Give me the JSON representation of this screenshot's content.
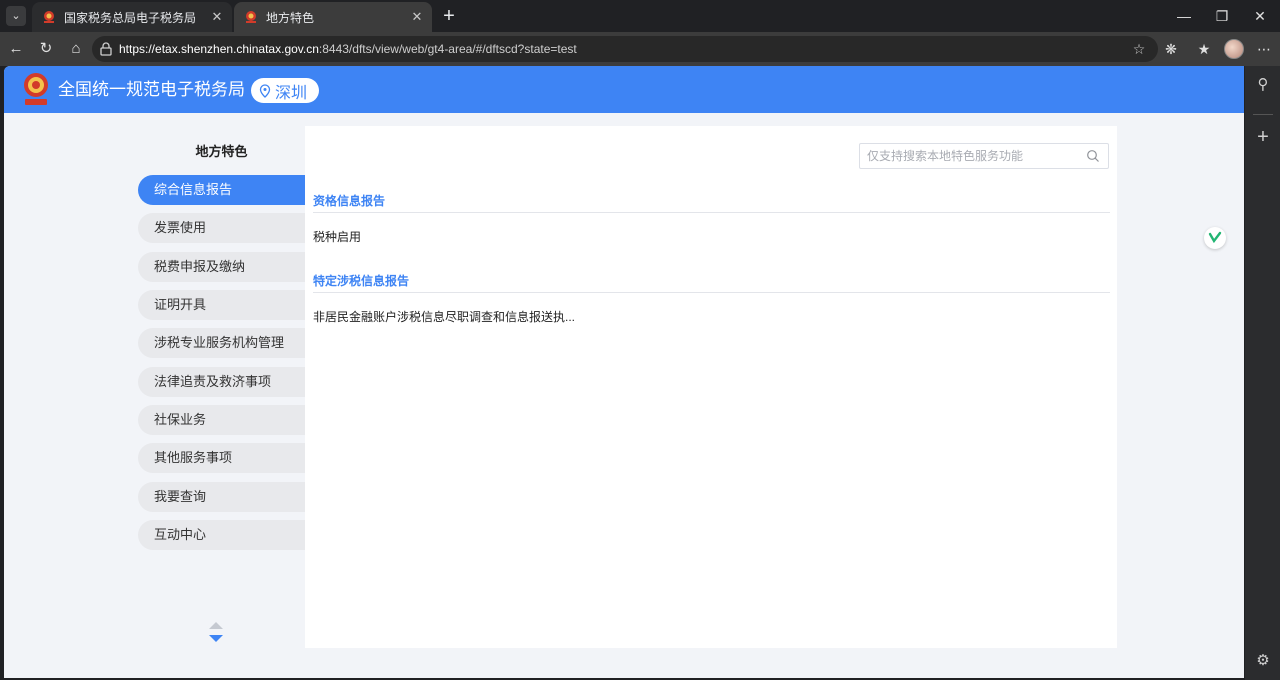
{
  "browser": {
    "tabs": [
      {
        "title": "国家税务总局电子税务局",
        "active": false
      },
      {
        "title": "地方特色",
        "active": true
      }
    ],
    "new_tab": "+",
    "url_host": "https://etax.shenzhen.chinatax.gov.cn",
    "url_rest": ":8443/dfts/view/web/gt4-area/#/dftscd?state=test"
  },
  "header": {
    "site_title": "全国统一规范电子税务局",
    "city": "深圳"
  },
  "sidebar": {
    "title": "地方特色",
    "items": [
      {
        "label": "综合信息报告",
        "active": true
      },
      {
        "label": "发票使用",
        "active": false
      },
      {
        "label": "税费申报及缴纳",
        "active": false
      },
      {
        "label": "证明开具",
        "active": false
      },
      {
        "label": "涉税专业服务机构管理",
        "active": false
      },
      {
        "label": "法律追责及救济事项",
        "active": false
      },
      {
        "label": "社保业务",
        "active": false
      },
      {
        "label": "其他服务事项",
        "active": false
      },
      {
        "label": "我要查询",
        "active": false
      },
      {
        "label": "互动中心",
        "active": false
      }
    ]
  },
  "search": {
    "placeholder": "仅支持搜索本地特色服务功能"
  },
  "sections": [
    {
      "title": "资格信息报告",
      "items": [
        "税种启用"
      ]
    },
    {
      "title": "特定涉税信息报告",
      "items": [
        "非居民金融账户涉税信息尽职调查和信息报送执..."
      ]
    }
  ],
  "colors": {
    "brand_blue": "#3e84f4",
    "page_bg": "#f2f4f8"
  },
  "icons": {
    "back": "back-arrow-icon",
    "reload": "reload-icon",
    "home": "home-icon",
    "favorite": "star-icon",
    "settings": "gear-icon"
  }
}
